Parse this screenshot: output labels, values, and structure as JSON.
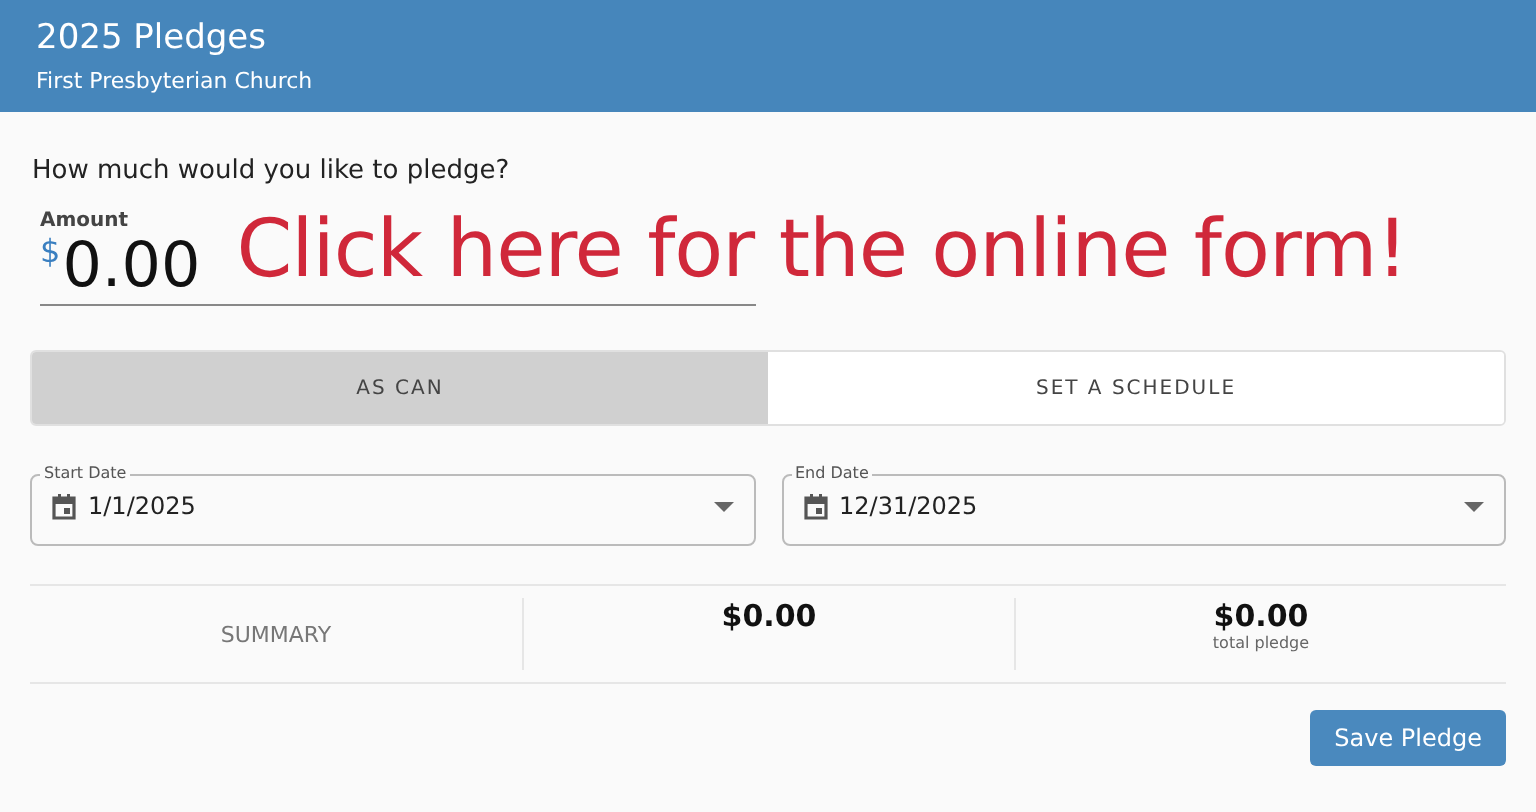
{
  "header": {
    "title": "2025 Pledges",
    "subtitle": "First Presbyterian Church"
  },
  "question": "How much would you like to pledge?",
  "amount": {
    "label": "Amount",
    "currency": "$",
    "value": "0.00"
  },
  "overlay_text": "Click here for the online form!",
  "modes": [
    {
      "label": "AS CAN",
      "selected": true
    },
    {
      "label": "SET A SCHEDULE",
      "selected": false
    }
  ],
  "dates": [
    {
      "label": "Start Date",
      "value": "1/1/2025"
    },
    {
      "label": "End Date",
      "value": "12/31/2025"
    }
  ],
  "summary": {
    "label": "SUMMARY",
    "amount": "$0.00",
    "total": "$0.00",
    "total_caption": "total pledge"
  },
  "save_button": "Save Pledge"
}
